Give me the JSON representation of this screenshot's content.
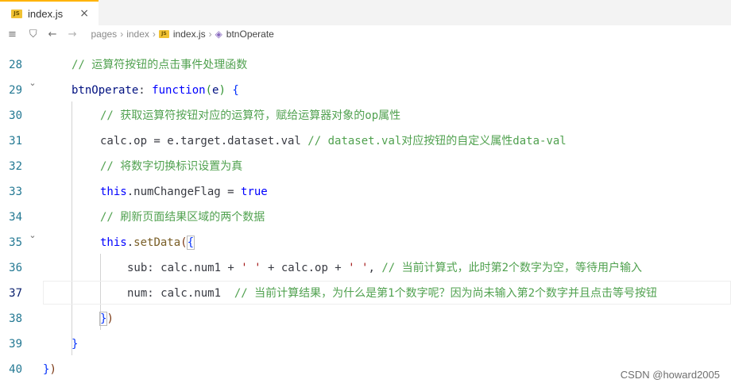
{
  "tab": {
    "icon": "js-file-icon",
    "icon_text": "JS",
    "label": "index.js",
    "close": "×"
  },
  "breadcrumb": {
    "list_icon": "≡",
    "bookmark_icon": "⛉",
    "back": "←",
    "forward": "→",
    "items": [
      "pages",
      "index",
      "index.js",
      "btnOperate"
    ],
    "sep": "›"
  },
  "lines": [
    {
      "n": "28"
    },
    {
      "n": "29"
    },
    {
      "n": "30"
    },
    {
      "n": "31"
    },
    {
      "n": "32"
    },
    {
      "n": "33"
    },
    {
      "n": "34"
    },
    {
      "n": "35"
    },
    {
      "n": "36"
    },
    {
      "n": "37"
    },
    {
      "n": "38"
    },
    {
      "n": "39"
    },
    {
      "n": "40"
    }
  ],
  "code": {
    "l28": "// 运算符按钮的点击事件处理函数",
    "l29_name": "btnOperate",
    "l29_colon": ": ",
    "l29_kw": "function",
    "l29_p1": "(",
    "l29_e": "e",
    "l29_p2": ")",
    "l29_brace": " {",
    "l30": "// 获取运算符按钮对应的运算符，赋给运算器对象的op属性",
    "l31_code": "calc.op = e.target.dataset.val ",
    "l31_comment": "// dataset.val对应按钮的自定义属性data-val",
    "l32": "// 将数字切换标识设置为真",
    "l33_this": "this",
    "l33_rest": ".numChangeFlag = ",
    "l33_true": "true",
    "l34": "// 刷新页面结果区域的两个数据",
    "l35_this": "this",
    "l35_dot": ".",
    "l35_fn": "setData",
    "l35_p": "(",
    "l35_b": "{",
    "l36_code": "sub: calc.num1 + ",
    "l36_s1": "' '",
    "l36_mid": " + calc.op + ",
    "l36_s2": "' '",
    "l36_comma": ", ",
    "l36_comment": "// 当前计算式，此时第2个数字为空，等待用户输入",
    "l37_code": "num: calc.num1  ",
    "l37_comment": "// 当前计算结果，为什么是第1个数字呢？因为尚未输入第2个数字并且点击等号按钮",
    "l38_b": "}",
    "l38_p": ")",
    "l39": "}",
    "l40_b": "}",
    "l40_p": ")"
  },
  "fold_icon": "⌄",
  "watermark": "CSDN @howard2005"
}
